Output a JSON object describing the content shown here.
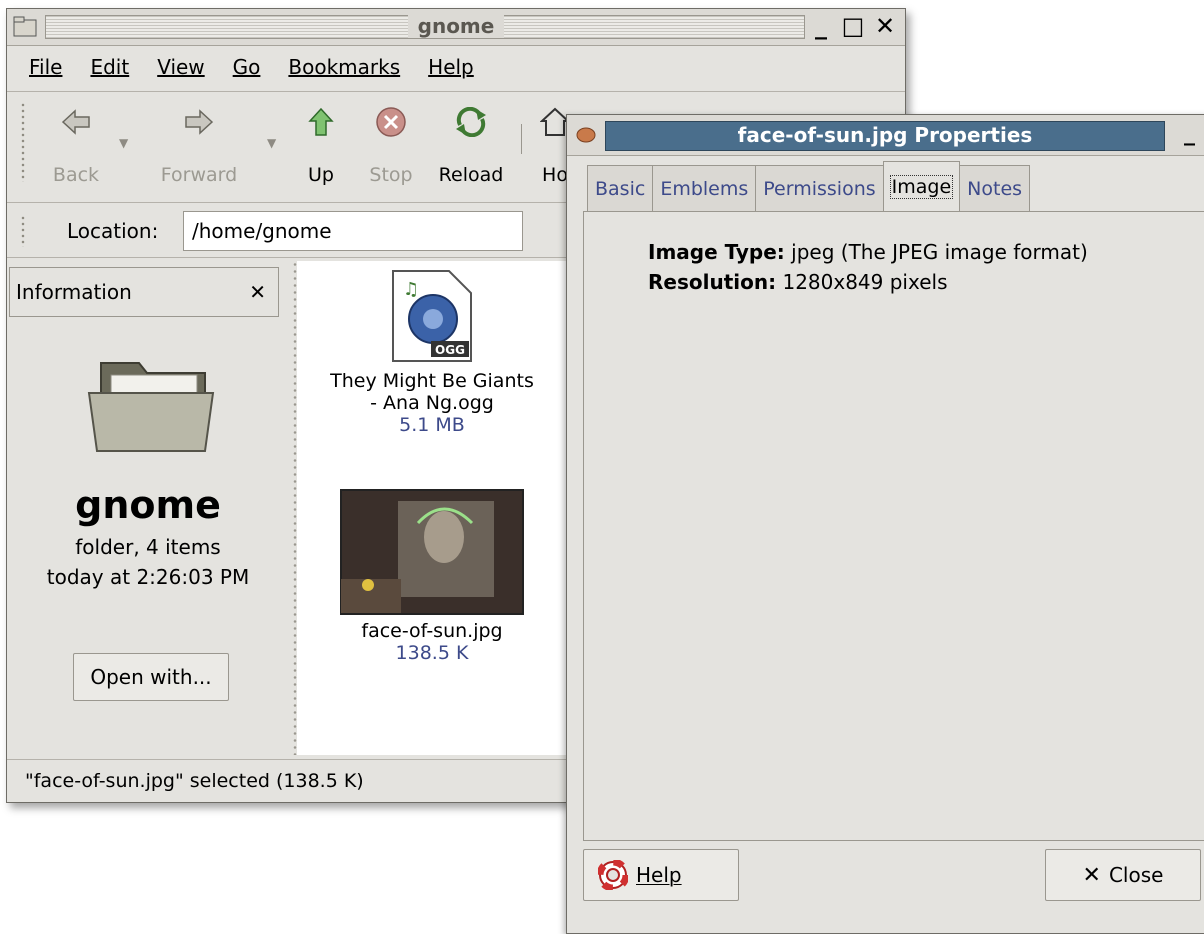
{
  "file_manager": {
    "title": "gnome",
    "menu": [
      "File",
      "Edit",
      "View",
      "Go",
      "Bookmarks",
      "Help"
    ],
    "toolbar": {
      "back": "Back",
      "forward": "Forward",
      "up": "Up",
      "stop": "Stop",
      "reload": "Reload",
      "home": "Ho"
    },
    "location_label": "Location:",
    "location_value": "/home/gnome",
    "sidebar": {
      "header": "Information",
      "folder_name": "gnome",
      "folder_info": "folder, 4 items",
      "modified": "today at 2:26:03 PM",
      "open_with": "Open with..."
    },
    "files": [
      {
        "name_line1": "They Might Be Giants",
        "name_line2": "- Ana Ng.ogg",
        "size": "5.1 MB",
        "badge": "OGG"
      },
      {
        "name_line1": "face-of-sun.jpg",
        "size": "138.5 K"
      }
    ],
    "status": "\"face-of-sun.jpg\" selected (138.5 K)"
  },
  "properties": {
    "title": "face-of-sun.jpg Properties",
    "tabs": [
      "Basic",
      "Emblems",
      "Permissions",
      "Image",
      "Notes"
    ],
    "active_tab": "Image",
    "image_type_label": "Image Type:",
    "image_type_value": "jpeg (The JPEG image format)",
    "resolution_label": "Resolution:",
    "resolution_value": "1280x849 pixels",
    "help": "Help",
    "close": "Close"
  },
  "colors": {
    "window_bg": "#e4e3df",
    "title_active": "#4a6e8c",
    "link_blue": "#3d4a8a"
  }
}
